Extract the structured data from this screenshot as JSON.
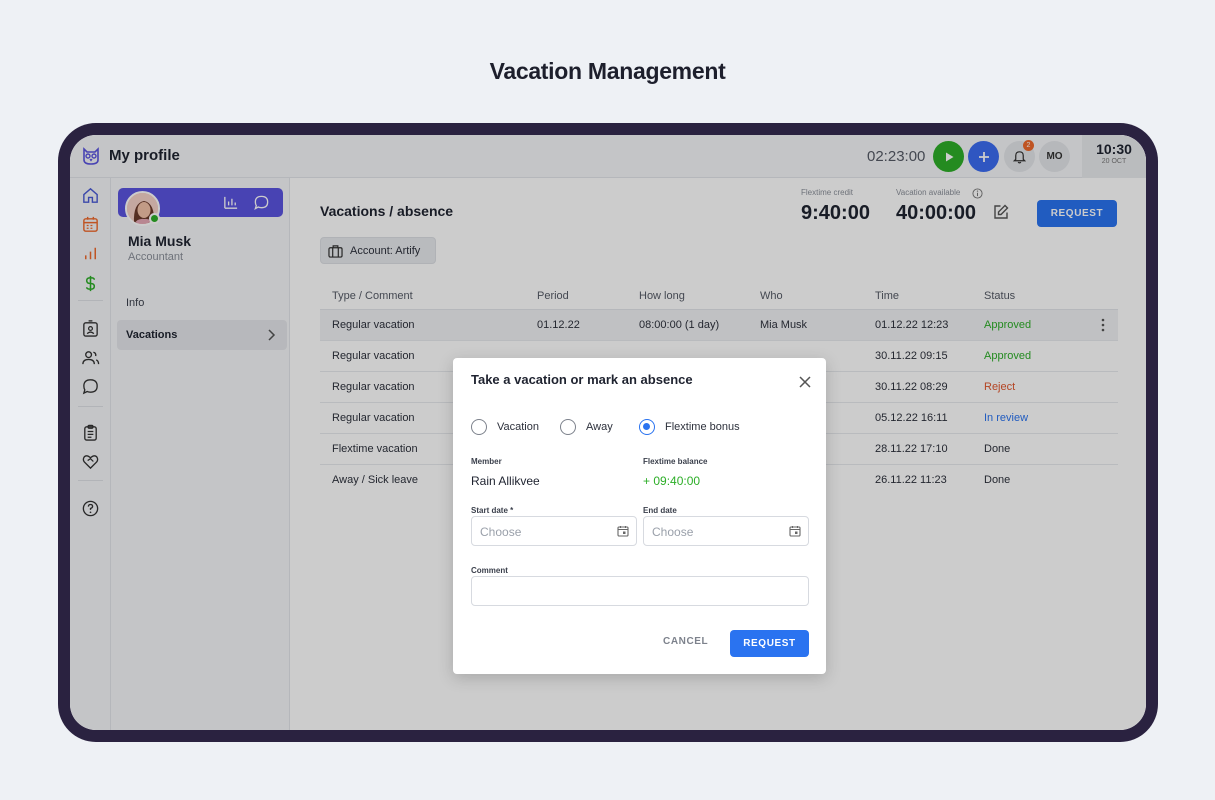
{
  "page": {
    "heading": "Vacation Management"
  },
  "topbar": {
    "app_title": "My profile",
    "logo_icon": "owl-logo-icon",
    "timer": "02:23:00",
    "notification_count": "2",
    "user_initials": "MO",
    "clock_time": "10:30",
    "clock_date": "20 OCT"
  },
  "rail": {
    "icons": [
      "home-icon",
      "calendar-icon",
      "bar-chart-icon",
      "dollar-icon",
      "badge-icon",
      "users-icon",
      "chat-icon",
      "clipboard-icon",
      "heart-handshake-icon",
      "help-icon"
    ]
  },
  "profile": {
    "name": "Mia Musk",
    "role": "Accountant",
    "nav": {
      "info": "Info",
      "vacations": "Vacations"
    }
  },
  "main": {
    "title": "Vacations / absence",
    "account_chip": "Account: Artify",
    "flextime_credit_label": "Flextime credit",
    "flextime_credit_value": "9:40:00",
    "vacation_available_label": "Vacation available",
    "vacation_available_value": "40:00:00",
    "request_label": "REQUEST",
    "table": {
      "headers": [
        "Type / Comment",
        "Period",
        "How long",
        "Who",
        "Time",
        "Status"
      ],
      "rows": [
        {
          "type": "Regular vacation",
          "period": "01.12.22",
          "how_long": "08:00:00 (1 day)",
          "who": "Mia Musk",
          "time": "01.12.22 12:23",
          "status": "Approved"
        },
        {
          "type": "Regular vacation",
          "period": "",
          "how_long": "",
          "who": "",
          "time": "30.11.22 09:15",
          "status": "Approved"
        },
        {
          "type": "Regular vacation",
          "period": "",
          "how_long": "",
          "who": "",
          "time": "30.11.22 08:29",
          "status": "Reject"
        },
        {
          "type": "Regular vacation",
          "period": "",
          "how_long": "",
          "who": "",
          "time": "05.12.22 16:11",
          "status": "In review"
        },
        {
          "type": "Flextime vacation",
          "period": "",
          "how_long": "",
          "who": "",
          "time": "28.11.22 17:10",
          "status": "Done"
        },
        {
          "type": "Away / Sick leave",
          "period": "",
          "how_long": "",
          "who": "",
          "time": "26.11.22 11:23",
          "status": "Done"
        }
      ]
    }
  },
  "modal": {
    "title": "Take a vacation or mark an absence",
    "options": [
      "Vacation",
      "Away",
      "Flextime bonus"
    ],
    "selected_option": "Flextime bonus",
    "member_label": "Member",
    "member_value": "Rain Allikvee",
    "balance_label": "Flextime balance",
    "balance_value": "+ 09:40:00",
    "start_label": "Start date *",
    "start_placeholder": "Choose",
    "end_label": "End date",
    "end_placeholder": "Choose",
    "comment_label": "Comment",
    "cancel_label": "CANCEL",
    "request_label": "REQUEST"
  },
  "colors": {
    "primary": "#2a73f0",
    "approved": "#2dae28",
    "reject": "#e2572d",
    "in_review": "#2a73f0",
    "profile_card": "#5b54e0",
    "device_frame": "#2a2240"
  }
}
